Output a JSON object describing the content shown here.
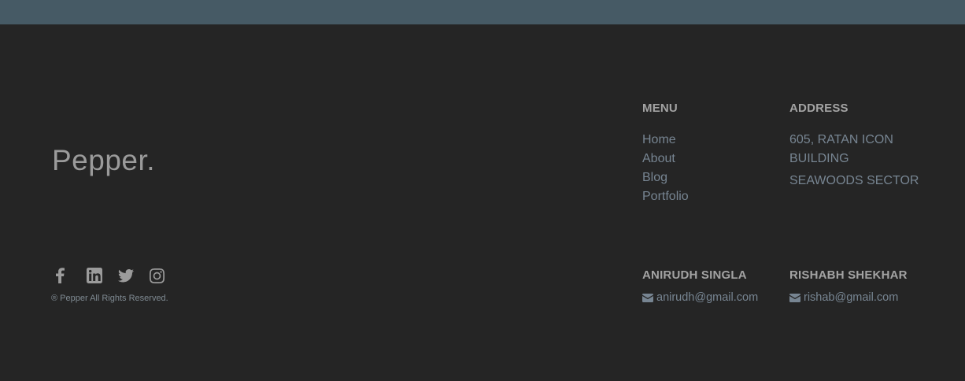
{
  "brand": {
    "name": "Pepper."
  },
  "social": {
    "icons": [
      "facebook-icon",
      "linkedin-icon",
      "twitter-icon",
      "instagram-icon"
    ]
  },
  "copyright": "® Pepper All Rights Reserved.",
  "menu": {
    "heading": "MENU",
    "items": [
      "Home",
      "About",
      "Blog",
      "Portfolio"
    ]
  },
  "address": {
    "heading": "ADDRESS",
    "line1": "605, RATAN ICON",
    "line2": "BUILDING",
    "line3": "SEAWOODS SECTOR"
  },
  "contact1": {
    "name": "ANIRUDH SINGLA",
    "email": "anirudh@gmail.com"
  },
  "contact2": {
    "name": "RISHABH SHEKHAR",
    "email": "rishab@gmail.com"
  },
  "colors": {
    "topband": "#465a65",
    "background": "#252525",
    "heading": "#a3a3a3",
    "link": "#778592"
  }
}
